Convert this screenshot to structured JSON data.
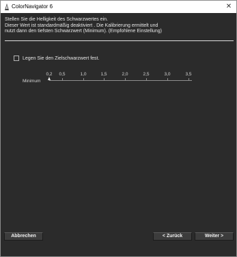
{
  "window": {
    "title": "ColorNavigator 6",
    "close_glyph": "✕",
    "icon": "colornavigator-app-icon"
  },
  "instructions": {
    "line1": "Stellen Sie die Helligkeit des Schwarzwertes ein.",
    "line2": "Dieser Wert ist standardmäßig deaktiviert . Die Kalibrierung ermittelt und",
    "line3": "nutzt dann den tiefsten Schwarzwert (Minimum). (Empfohlene Einstellung)"
  },
  "target_checkbox": {
    "label": "Legen Sie den Zielschwarzwert fest.",
    "checked": false
  },
  "slider": {
    "label": "Minimum",
    "ticks": [
      "0,2",
      "0,5",
      "1,0",
      "1,5",
      "2,0",
      "2,5",
      "3,0",
      "3,5"
    ],
    "value_label": "Minimum"
  },
  "buttons": {
    "cancel": "Abbrechen",
    "back": "< Zurück",
    "next": "Weiter >"
  },
  "colors": {
    "background": "#2b2b2b",
    "text": "#e6e6e6"
  }
}
